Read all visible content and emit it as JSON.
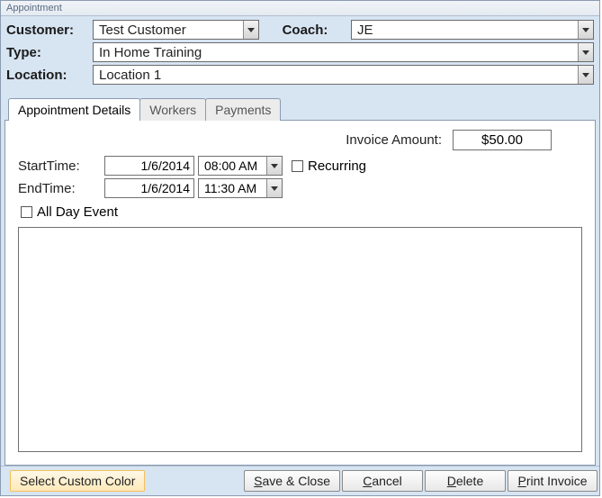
{
  "window": {
    "title": "Appointment"
  },
  "header": {
    "customer_label": "Customer:",
    "customer_value": "Test Customer",
    "coach_label": "Coach:",
    "coach_value": "JE",
    "type_label": "Type:",
    "type_value": "In Home Training",
    "location_label": "Location:",
    "location_value": "Location 1"
  },
  "tabs": {
    "details": "Appointment Details",
    "workers": "Workers",
    "payments": "Payments"
  },
  "details": {
    "invoice_label": "Invoice Amount:",
    "invoice_value": "$50.00",
    "start_label": "StartTime:",
    "start_date": "1/6/2014",
    "start_time": "08:00 AM",
    "recurring_label": "Recurring",
    "end_label": "EndTime:",
    "end_date": "1/6/2014",
    "end_time": "11:30 AM",
    "allday_label": "All Day Event"
  },
  "footer": {
    "color": "Select Custom Color",
    "save": "Save & Close",
    "cancel": "Cancel",
    "delete": "Delete",
    "print": "Print Invoice"
  }
}
